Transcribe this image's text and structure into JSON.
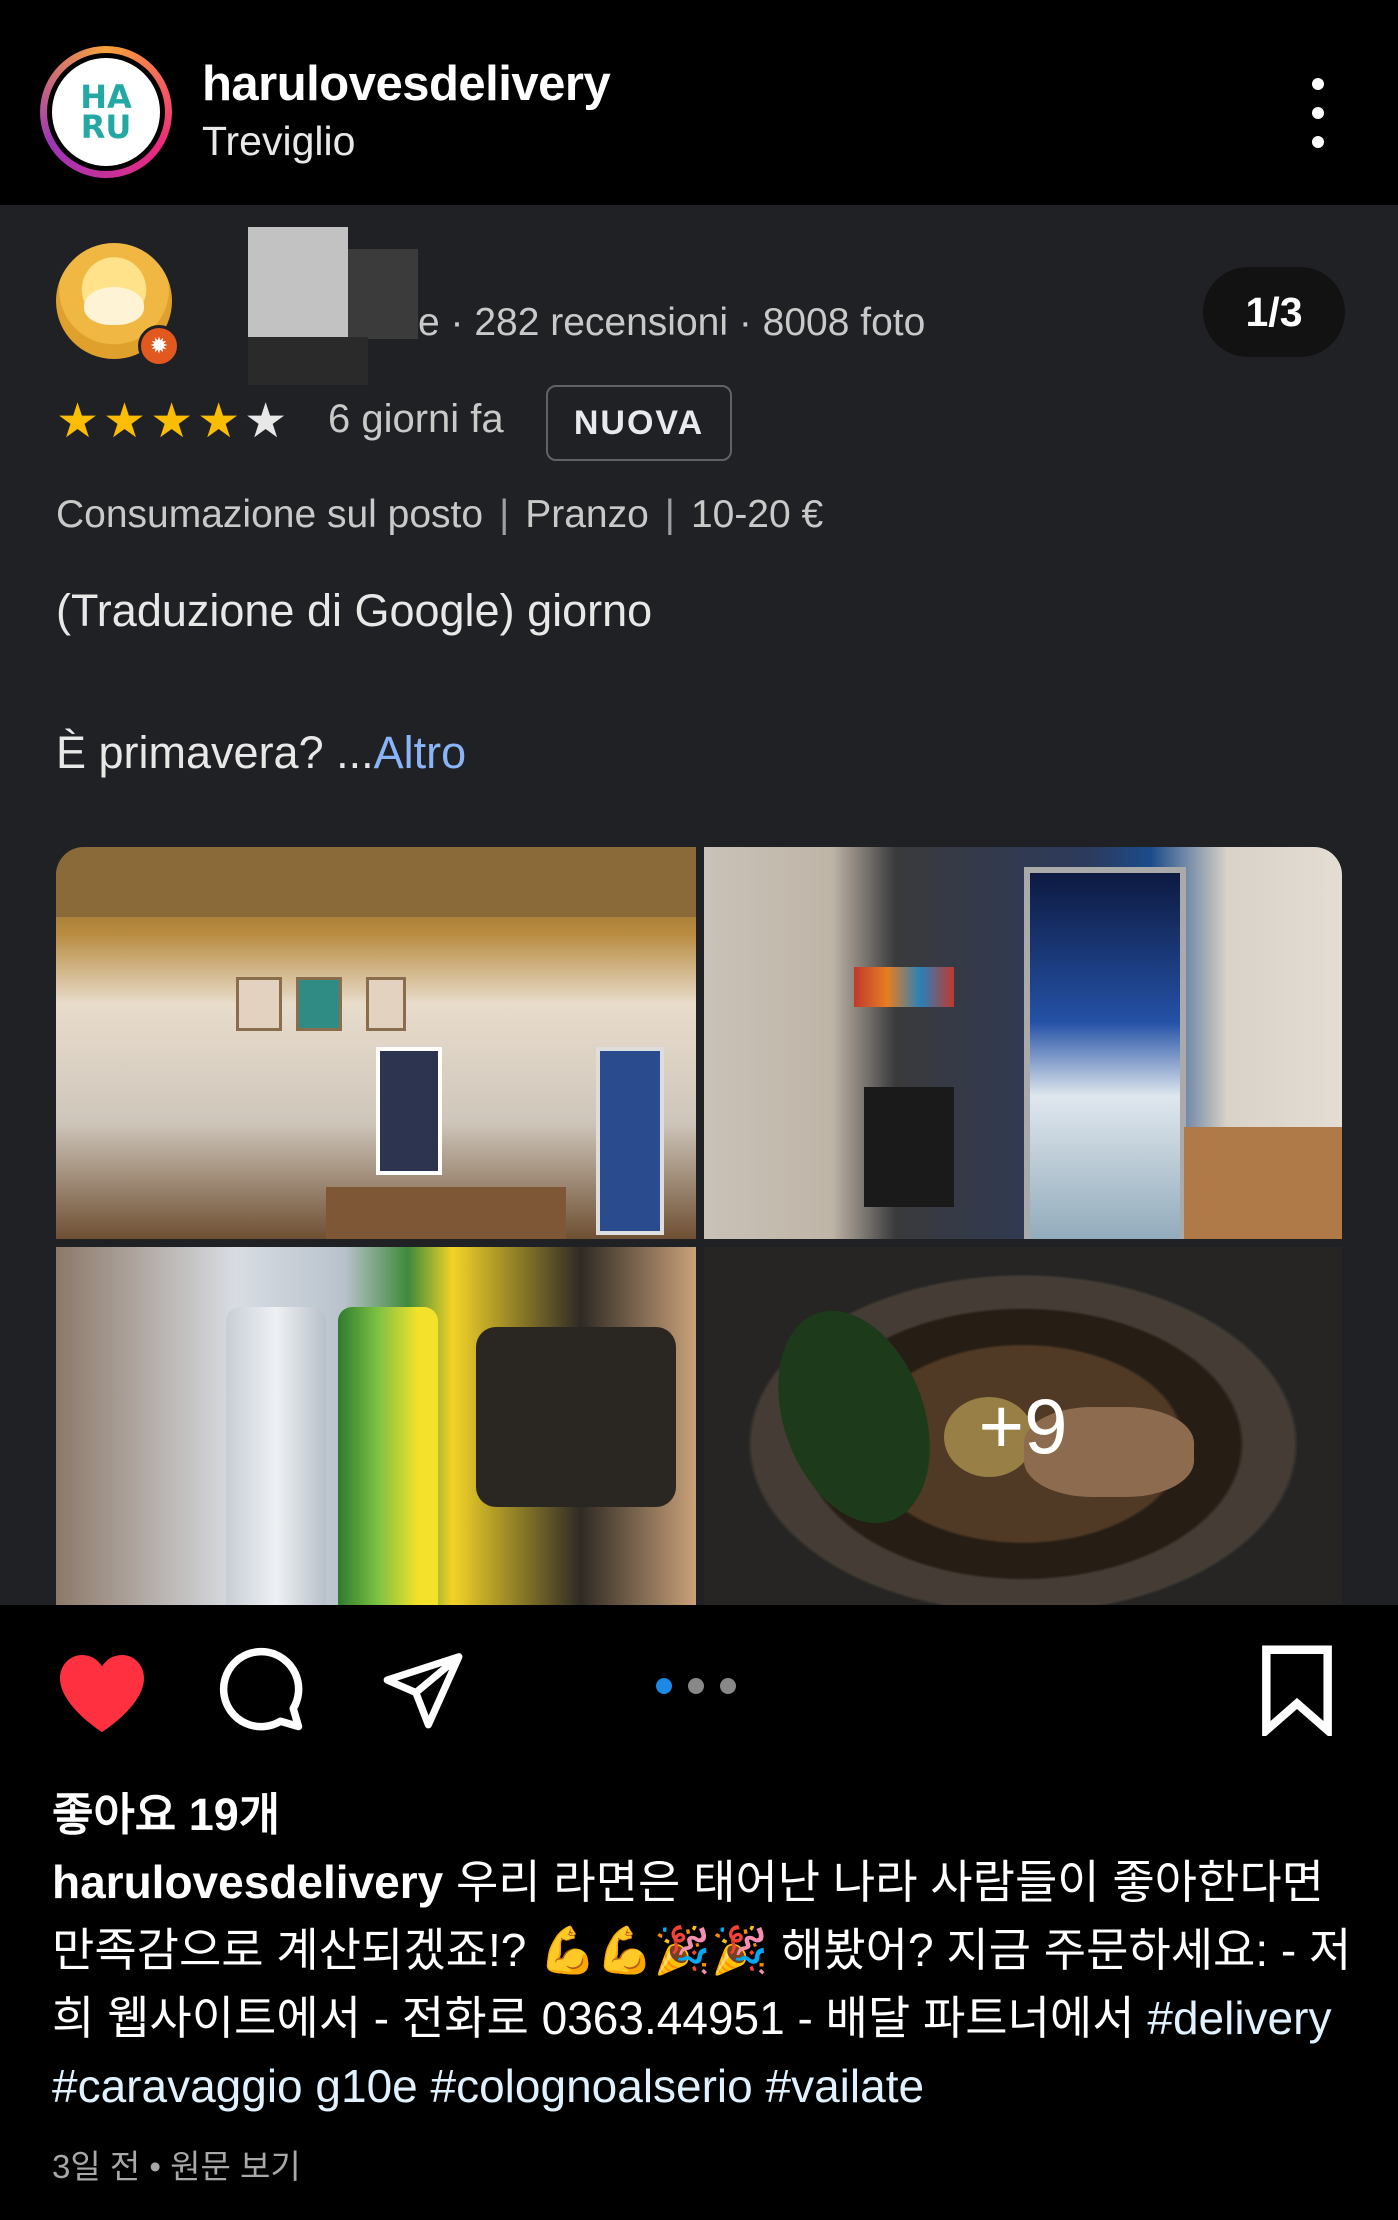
{
  "header": {
    "avatar_text_top": "HA",
    "avatar_text_bottom": "RU",
    "username": "harulovesdelivery",
    "location": "Treviglio",
    "more_icon": "more-vertical-icon"
  },
  "media": {
    "page_counter": "1/3",
    "review": {
      "meta": "e · 282 recensioni · 8008 foto",
      "rating": 4,
      "rating_max": 5,
      "date": "6 giorni fa",
      "badge": "NUOVA",
      "tags": [
        "Consumazione sul posto",
        "Pranzo",
        "10-20 €"
      ],
      "text_line_1": "(Traduzione di Google) giorno",
      "text_line_2": "È primavera? ...",
      "more_link": "Altro",
      "extra_photos": "+9"
    }
  },
  "actions": {
    "like_icon": "heart-filled-icon",
    "comment_icon": "comment-icon",
    "share_icon": "paper-plane-icon",
    "save_icon": "bookmark-icon",
    "carousel_dots": 3,
    "carousel_active": 0,
    "like_color": "#ff3040"
  },
  "likes": "좋아요 19개",
  "caption": {
    "username": "harulovesdelivery",
    "text": " 우리 라면은 태어난 나라 사람들이 좋아한다면 만족감으로 계산되겠죠!? 💪💪🎉🎉 해봤어? 지금 주문하세요: - 저희 웹사이트에서 - 전화로 0363.44951 - 배달 파트너에서 ",
    "hashtags": "#delivery #caravaggio g10e #colognoalserio #vailate"
  },
  "timestamp": "3일 전 • 원문 보기"
}
